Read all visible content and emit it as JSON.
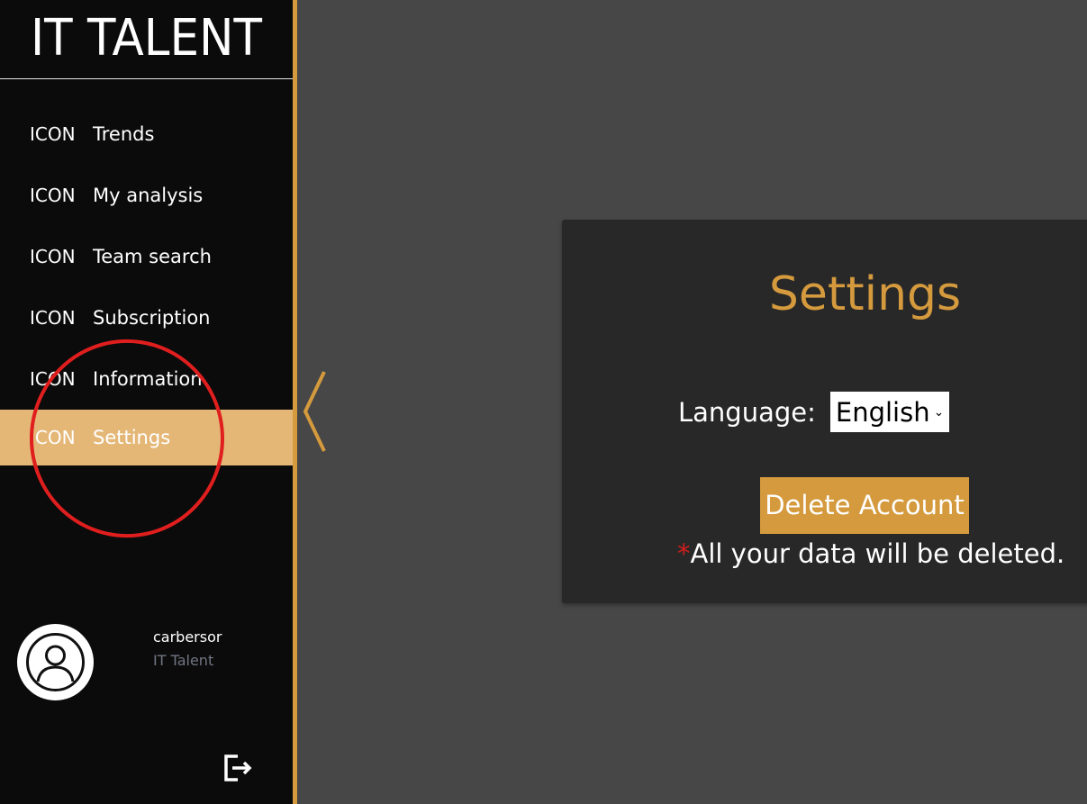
{
  "app": {
    "brand": "IT TALENT"
  },
  "sidebar": {
    "items": [
      {
        "icon": "ICON",
        "label": "Trends"
      },
      {
        "icon": "ICON",
        "label": "My analysis"
      },
      {
        "icon": "ICON",
        "label": "Team search"
      },
      {
        "icon": "ICON",
        "label": "Subscription"
      },
      {
        "icon": "ICON",
        "label": "Information"
      },
      {
        "icon": "ICON",
        "label": "Settings",
        "active": true
      }
    ]
  },
  "profile": {
    "username": "carbersor",
    "organization": "IT Talent"
  },
  "settings": {
    "title": "Settings",
    "language_label": "Language:",
    "language_value": "English",
    "delete_button": "Delete Account",
    "warning_asterisk": "*",
    "warning_text": "All your data will be deleted."
  },
  "colors": {
    "accent": "#d49a3d",
    "active_item": "#e4b777",
    "sidebar_bg": "#0b0b0b",
    "main_bg": "#474747",
    "card_bg": "#282828",
    "annotation": "#e01e1e"
  },
  "icons": {
    "avatar": "user-circle-icon",
    "logout": "logout-icon",
    "collapse": "chevron-left-icon"
  }
}
